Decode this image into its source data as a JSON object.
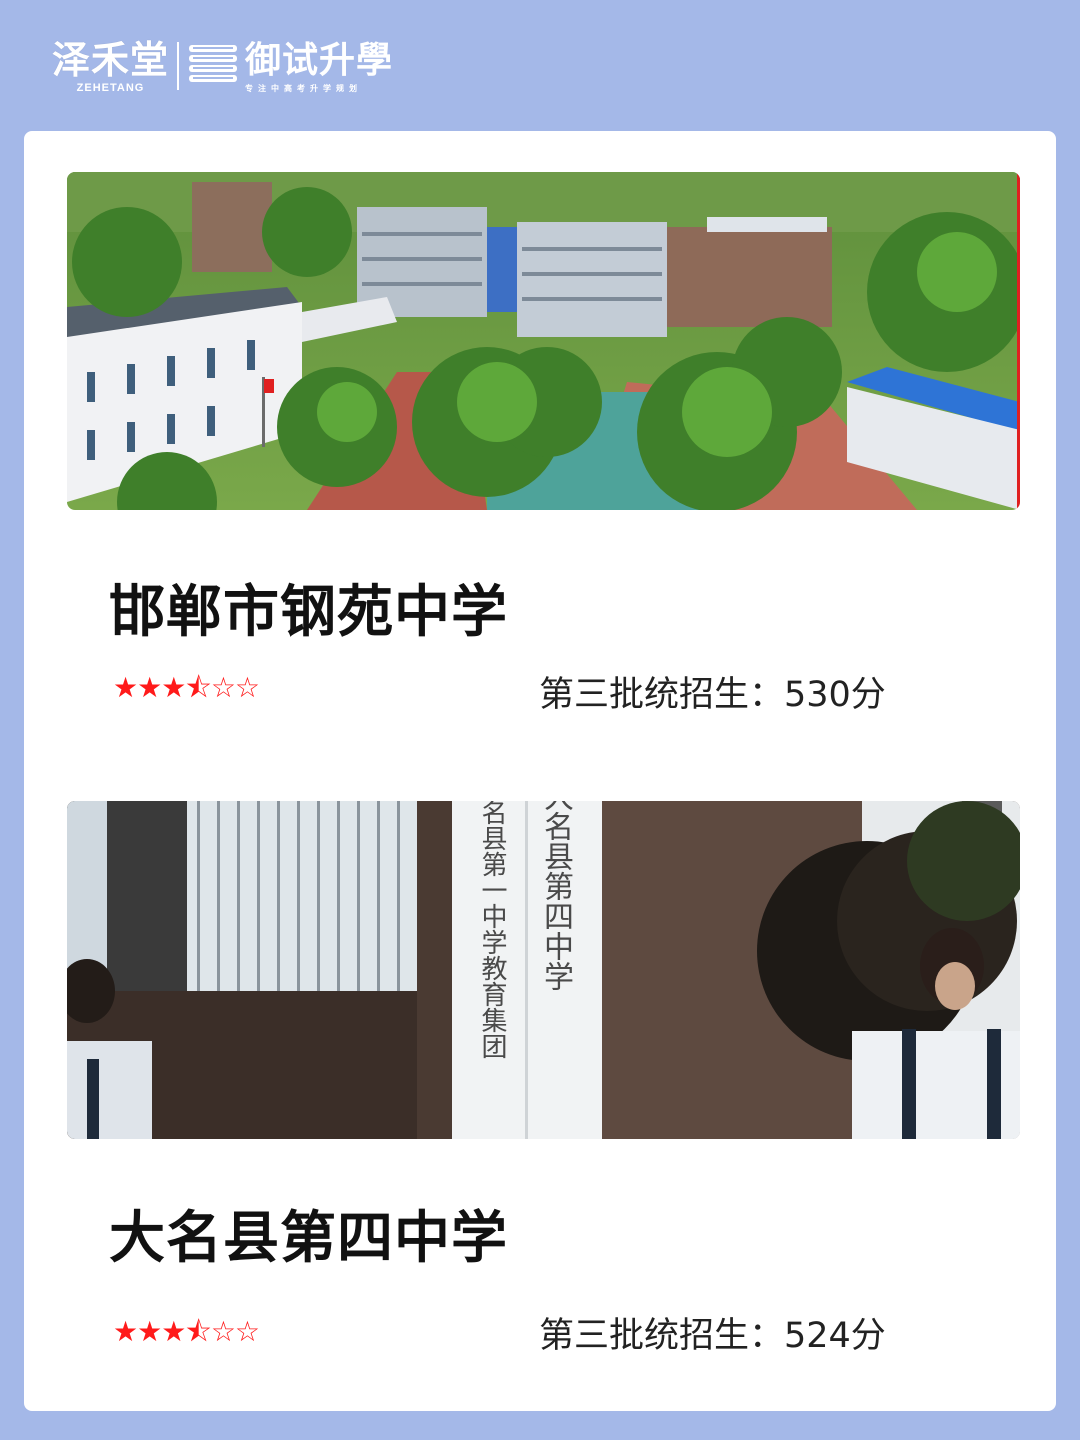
{
  "brand": {
    "name_cn": "泽禾堂",
    "name_en": "ZEHETANG",
    "subtitle_cn": "御试升學",
    "slogan": "专注中高考升学规划",
    "logo_icon": "book-stack-icon"
  },
  "schools": [
    {
      "name": "邯郸市钢苑中学",
      "rating_text": "★★★⯪☆☆",
      "rating_value": 3.5,
      "rating_max": 6,
      "admission": "第三批统招生：530分",
      "photo_sign": []
    },
    {
      "name": "大名县第四中学",
      "rating_text": "★★★⯪☆☆",
      "rating_value": 3.5,
      "rating_max": 6,
      "admission": "第三批统招生：524分",
      "photo_sign": [
        "大名县第四中学",
        "大名县第一中学教育集团"
      ]
    }
  ],
  "colors": {
    "background": "#a4b8e8",
    "card": "#ffffff",
    "star": "#ff1a1a",
    "title": "#111111"
  }
}
